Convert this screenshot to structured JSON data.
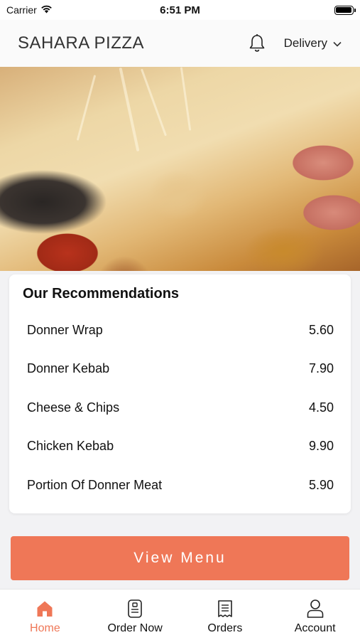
{
  "status_bar": {
    "carrier": "Carrier",
    "time": "6:51 PM",
    "battery_level": 1.0
  },
  "header": {
    "brand": "SAHARA PIZZA",
    "order_mode": "Delivery",
    "icons": {
      "notifications": "bell-icon",
      "mode_dropdown": "chevron-down-icon"
    }
  },
  "hero": {
    "description_icon": "pizza-photo"
  },
  "recommendations": {
    "title": "Our Recommendations",
    "items": [
      {
        "name": "Donner Wrap",
        "price": "5.60"
      },
      {
        "name": "Donner Kebab",
        "price": "7.90"
      },
      {
        "name": "Cheese & Chips",
        "price": "4.50"
      },
      {
        "name": "Chicken Kebab",
        "price": "9.90"
      },
      {
        "name": "Portion Of Donner Meat",
        "price": "5.90"
      }
    ]
  },
  "view_menu_label": "View Menu",
  "tabs": [
    {
      "label": "Home",
      "icon": "home-icon",
      "active": true
    },
    {
      "label": "Order Now",
      "icon": "order-icon",
      "active": false
    },
    {
      "label": "Orders",
      "icon": "receipt-icon",
      "active": false
    },
    {
      "label": "Account",
      "icon": "user-icon",
      "active": false
    }
  ],
  "colors": {
    "accent": "#ef7757",
    "background": "#f2f2f4",
    "card": "#ffffff"
  }
}
